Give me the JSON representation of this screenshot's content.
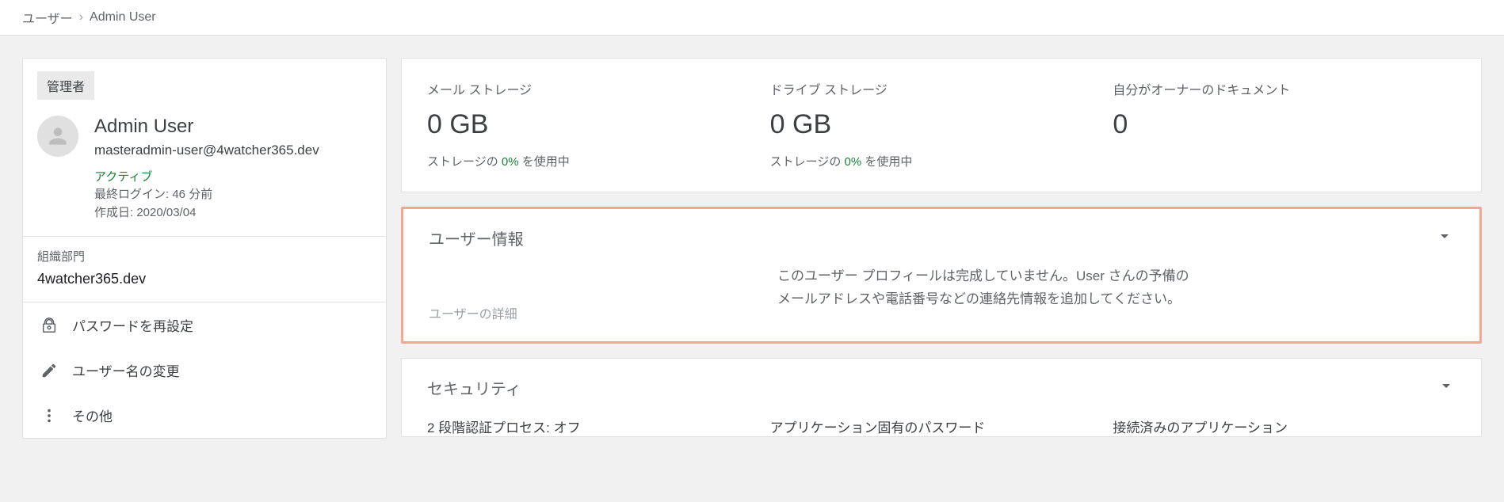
{
  "breadcrumb": {
    "root": "ユーザー",
    "current": "Admin User"
  },
  "sidebar": {
    "badge": "管理者",
    "name": "Admin User",
    "email": "masteradmin-user@4watcher365.dev",
    "status": "アクティブ",
    "last_login": "最終ログイン: 46 分前",
    "created": "作成日: 2020/03/04",
    "org_label": "組織部門",
    "org_value": "4watcher365.dev",
    "actions": {
      "reset_password": "パスワードを再設定",
      "rename_user": "ユーザー名の変更",
      "more": "その他"
    }
  },
  "stats": {
    "mail": {
      "label": "メール ストレージ",
      "value": "0 GB",
      "sub_pre": "ストレージの ",
      "pct": "0%",
      "sub_post": " を使用中"
    },
    "drive": {
      "label": "ドライブ ストレージ",
      "value": "0 GB",
      "sub_pre": "ストレージの ",
      "pct": "0%",
      "sub_post": " を使用中"
    },
    "docs": {
      "label": "自分がオーナーのドキュメント",
      "value": "0"
    }
  },
  "user_info": {
    "title": "ユーザー情報",
    "sublink": "ユーザーの詳細",
    "message": "このユーザー プロフィールは完成していません。User さんの予備のメールアドレスや電話番号などの連絡先情報を追加してください。"
  },
  "security": {
    "title": "セキュリティ",
    "two_step": "2 段階認証プロセス: オフ",
    "app_passwords": "アプリケーション固有のパスワード",
    "connected_apps": "接続済みのアプリケーション"
  }
}
